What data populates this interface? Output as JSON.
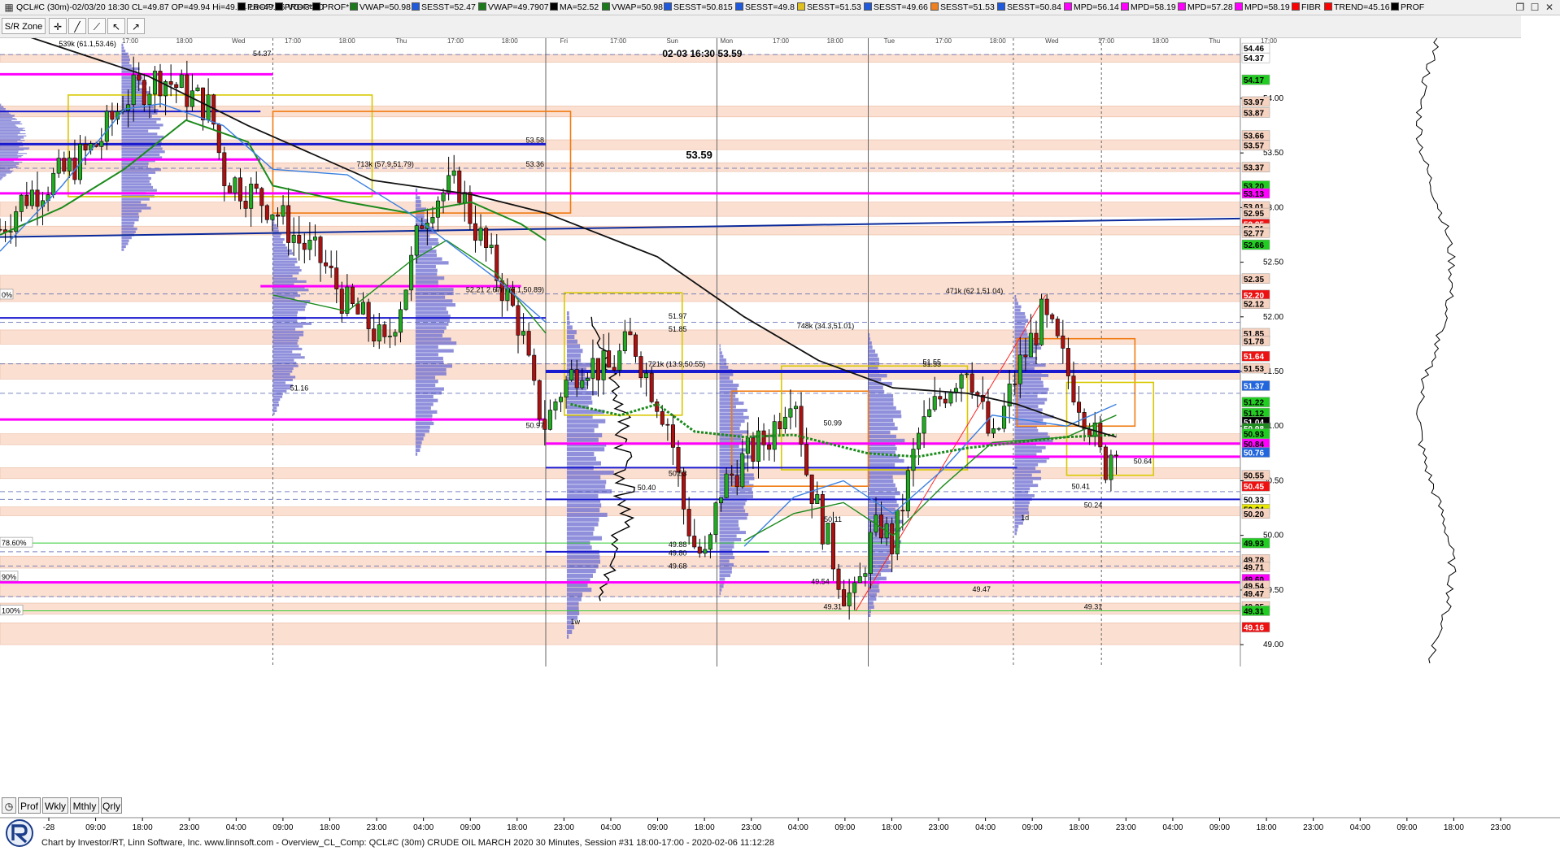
{
  "window": {
    "symbol_info": "QCL#C (30m)-02/03/20 18:30 CL=49.87 OP=49.94 Hi=49.94 Lo=49.66 VO=3410",
    "indicators": [
      {
        "label": "PROF*",
        "color": "#000000"
      },
      {
        "label": "PROF*",
        "color": "#000000"
      },
      {
        "label": "PROF*",
        "color": "#000000"
      },
      {
        "label": "VWAP=50.98",
        "color": "#1a7a1a"
      },
      {
        "label": "SESST=52.47",
        "color": "#1e5adb"
      },
      {
        "label": "VWAP=49.7907",
        "color": "#1a7a1a"
      },
      {
        "label": "MA=52.52",
        "color": "#000000"
      },
      {
        "label": "VWAP=50.98",
        "color": "#1a7a1a"
      },
      {
        "label": "SESST=50.815",
        "color": "#1e5adb"
      },
      {
        "label": "SESST=49.8",
        "color": "#1e5adb"
      },
      {
        "label": "SESST=51.53",
        "color": "#e0c020"
      },
      {
        "label": "SESST=49.66",
        "color": "#1e5adb"
      },
      {
        "label": "SESST=51.53",
        "color": "#f08020"
      },
      {
        "label": "SESST=50.84",
        "color": "#1e5adb"
      },
      {
        "label": "MPD=56.14",
        "color": "#ff00ff"
      },
      {
        "label": "MPD=58.19",
        "color": "#ff00ff"
      },
      {
        "label": "MPD=57.28",
        "color": "#ff00ff"
      },
      {
        "label": "MPD=58.19",
        "color": "#ff00ff"
      },
      {
        "label": "FIBR",
        "color": "#ff0000"
      },
      {
        "label": "TREND=45.16",
        "color": "#ff0000"
      },
      {
        "label": "PROF",
        "color": "#000000"
      }
    ],
    "toolbar_label": "PROF",
    "toolbar_icons": [
      "grid-icon",
      "stack-icon",
      "zoom-icon",
      "bars-icon",
      "wave-icon",
      "title-icon",
      "wave2-icon",
      "hourglass-icon"
    ]
  },
  "toolbar2": {
    "sr_zone_label": "S/R Zone",
    "tools": [
      "cross-icon",
      "line-icon",
      "line2-icon",
      "pointer-icon",
      "arrow-icon"
    ]
  },
  "bottom_tabs": [
    "Prof",
    "Wkly",
    "Mthly",
    "Qrly"
  ],
  "footer": {
    "text": "Chart by Investor/RT, Linn Software, Inc. www.linnsoft.com - Overview_CL_Comp: QCL#C (30m) CRUDE OIL MARCH 2020 30 Minutes, Session #31 18:00-17:00 - 2020-02-06 11:12:28"
  },
  "colors": {
    "zone_fill": "#fbe0d2",
    "magenta": "#ff00ff",
    "blue_line": "#1a1acf",
    "navy": "#0a2a9a",
    "green_vwap": "#1c8a1c",
    "ma": "#111111",
    "profile": "#6a6ad0",
    "up_candle": "#22aa22",
    "down_candle": "#aa1111",
    "orange": "#f07a10",
    "yellow": "#d8c800"
  },
  "chart_data": {
    "type": "candlestick",
    "title": "02-03 16:30  53.59",
    "subtitle": "53.59",
    "ylim": [
      48.8,
      54.55
    ],
    "y_tick_labels": [
      "54.00",
      "53.50",
      "53.00",
      "52.50",
      "52.00",
      "51.50",
      "51.00",
      "50.50",
      "50.00",
      "49.50",
      "49.00"
    ],
    "y_ticks": [
      54.0,
      53.5,
      53.0,
      52.5,
      52.0,
      51.5,
      51.0,
      50.5,
      50.0,
      49.5,
      49.0
    ],
    "x_tick_labels": [
      "-28",
      "09:00",
      "18:00",
      "23:00",
      "04:00",
      "09:00",
      "18:00",
      "23:00",
      "04:00",
      "09:00",
      "18:00",
      "23:00",
      "04:00",
      "09:00",
      "18:00",
      "23:00",
      "04:00",
      "09:00",
      "18:00",
      "23:00",
      "04:00",
      "09:00",
      "18:00",
      "23:00",
      "04:00",
      "09:00",
      "18:00",
      "23:00",
      "04:00",
      "09:00",
      "18:00",
      "23:00"
    ],
    "day_labels": [
      "17:00",
      "18:00",
      "Wed",
      "17:00",
      "18:00",
      "Thu",
      "17:00",
      "18:00",
      "Fri",
      "17:00",
      "Sun",
      "Mon",
      "17:00",
      "18:00",
      "Tue",
      "17:00",
      "18:00",
      "Wed",
      "17:00",
      "18:00",
      "Thu",
      "17:00"
    ],
    "price_labels": [
      {
        "value": 54.37,
        "label": "54.37",
        "bg": "#ffffff",
        "fg": "#000000"
      },
      {
        "value": 54.46,
        "label": "54.46",
        "bg": "#ffffff",
        "fg": "#000000"
      },
      {
        "value": 54.17,
        "label": "54.17",
        "bg": "#22cc22",
        "fg": "#000000"
      },
      {
        "value": 53.97,
        "label": "53.97",
        "bg": "#f6d2c0",
        "fg": "#000000"
      },
      {
        "value": 53.87,
        "label": "53.87",
        "bg": "#f6d2c0",
        "fg": "#000000"
      },
      {
        "value": 53.66,
        "label": "53.66",
        "bg": "#f6d2c0",
        "fg": "#000000"
      },
      {
        "value": 53.57,
        "label": "53.57",
        "bg": "#f6d2c0",
        "fg": "#000000"
      },
      {
        "value": 53.37,
        "label": "53.37",
        "bg": "#f6d2c0",
        "fg": "#000000"
      },
      {
        "value": 53.2,
        "label": "53.20",
        "bg": "#22cc22",
        "fg": "#000000"
      },
      {
        "value": 53.13,
        "label": "53.13",
        "bg": "#ff00ff",
        "fg": "#000000"
      },
      {
        "value": 53.01,
        "label": "53.01",
        "bg": "#f6d2c0",
        "fg": "#000000"
      },
      {
        "value": 52.95,
        "label": "52.95",
        "bg": "#f6d2c0",
        "fg": "#000000"
      },
      {
        "value": 52.85,
        "label": "52.85",
        "bg": "#ee1111",
        "fg": "#ffffff"
      },
      {
        "value": 52.81,
        "label": "52.81",
        "bg": "#f6d2c0",
        "fg": "#000000"
      },
      {
        "value": 52.77,
        "label": "52.77",
        "bg": "#f6d2c0",
        "fg": "#000000"
      },
      {
        "value": 52.66,
        "label": "52.66",
        "bg": "#22cc22",
        "fg": "#000000"
      },
      {
        "value": 52.35,
        "label": "52.35",
        "bg": "#f6d2c0",
        "fg": "#000000"
      },
      {
        "value": 52.2,
        "label": "52.20",
        "bg": "#ee1111",
        "fg": "#ffffff"
      },
      {
        "value": 52.12,
        "label": "52.12",
        "bg": "#f6d2c0",
        "fg": "#000000"
      },
      {
        "value": 51.85,
        "label": "51.85",
        "bg": "#f6d2c0",
        "fg": "#000000"
      },
      {
        "value": 51.78,
        "label": "51.78",
        "bg": "#f6d2c0",
        "fg": "#000000"
      },
      {
        "value": 51.64,
        "label": "51.64",
        "bg": "#ee1111",
        "fg": "#ffffff"
      },
      {
        "value": 51.53,
        "label": "51.53",
        "bg": "#f6d2c0",
        "fg": "#000000"
      },
      {
        "value": 51.37,
        "label": "51.37",
        "bg": "#2266dd",
        "fg": "#ffffff"
      },
      {
        "value": 51.22,
        "label": "51.22",
        "bg": "#22cc22",
        "fg": "#000000"
      },
      {
        "value": 51.12,
        "label": "51.12",
        "bg": "#22cc22",
        "fg": "#000000"
      },
      {
        "value": 51.04,
        "label": "51.04",
        "bg": "#000000",
        "fg": "#ffffff"
      },
      {
        "value": 50.98,
        "label": "50.98",
        "bg": "#1c8a1c",
        "fg": "#ffffff"
      },
      {
        "value": 50.93,
        "label": "50.93",
        "bg": "#22cc22",
        "fg": "#000000"
      },
      {
        "value": 50.84,
        "label": "50.84",
        "bg": "#ff00ff",
        "fg": "#000000"
      },
      {
        "value": 50.76,
        "label": "50.76",
        "bg": "#2266dd",
        "fg": "#ffffff"
      },
      {
        "value": 50.55,
        "label": "50.55",
        "bg": "#f6d2c0",
        "fg": "#000000"
      },
      {
        "value": 50.45,
        "label": "50.45",
        "bg": "#ee1111",
        "fg": "#ffffff"
      },
      {
        "value": 50.33,
        "label": "50.33",
        "bg": "#ffffff",
        "fg": "#000000"
      },
      {
        "value": 50.24,
        "label": "50.24",
        "bg": "#e8e800",
        "fg": "#000000"
      },
      {
        "value": 50.2,
        "label": "50.20",
        "bg": "#f6d2c0",
        "fg": "#000000"
      },
      {
        "value": 49.93,
        "label": "49.93",
        "bg": "#22cc22",
        "fg": "#000000"
      },
      {
        "value": 49.78,
        "label": "49.78",
        "bg": "#f6d2c0",
        "fg": "#000000"
      },
      {
        "value": 49.71,
        "label": "49.71",
        "bg": "#f6d2c0",
        "fg": "#000000"
      },
      {
        "value": 49.6,
        "label": "49.60",
        "bg": "#ff00ff",
        "fg": "#000000"
      },
      {
        "value": 49.54,
        "label": "49.54",
        "bg": "#f6d2c0",
        "fg": "#000000"
      },
      {
        "value": 49.47,
        "label": "49.47",
        "bg": "#f6d2c0",
        "fg": "#000000"
      },
      {
        "value": 49.35,
        "label": "49.35",
        "bg": "#f6d2c0",
        "fg": "#000000"
      },
      {
        "value": 49.31,
        "label": "49.31",
        "bg": "#22cc22",
        "fg": "#000000"
      },
      {
        "value": 49.16,
        "label": "49.16",
        "bg": "#ee1111",
        "fg": "#ffffff"
      }
    ],
    "zones": [
      [
        54.33,
        54.4
      ],
      [
        53.83,
        53.93
      ],
      [
        53.53,
        53.62
      ],
      [
        53.33,
        53.41
      ],
      [
        52.92,
        53.05
      ],
      [
        52.75,
        52.83
      ],
      [
        52.14,
        52.38
      ],
      [
        51.75,
        51.88
      ],
      [
        51.43,
        51.57
      ],
      [
        50.83,
        50.93
      ],
      [
        50.52,
        50.62
      ],
      [
        50.18,
        50.26
      ],
      [
        49.7,
        49.81
      ],
      [
        49.44,
        49.55
      ],
      [
        49.28,
        49.38
      ],
      [
        49.0,
        49.2
      ]
    ],
    "magenta_levels": [
      {
        "value": 54.22,
        "x0": 0,
        "x1": 0.22
      },
      {
        "value": 53.44,
        "x0": 0,
        "x1": 0.21
      },
      {
        "value": 53.13,
        "x0": 0,
        "x1": 1.0
      },
      {
        "value": 52.28,
        "x0": 0.21,
        "x1": 0.42
      },
      {
        "value": 51.06,
        "x0": 0,
        "x1": 0.44
      },
      {
        "value": 50.84,
        "x0": 0.44,
        "x1": 1.0
      },
      {
        "value": 50.72,
        "x0": 0.78,
        "x1": 1.0
      },
      {
        "value": 49.57,
        "x0": 0,
        "x1": 1.0
      }
    ],
    "blue_levels": [
      {
        "value": 53.58,
        "x0": 0,
        "x1": 0.44,
        "w": 3
      },
      {
        "value": 53.88,
        "x0": 0,
        "x1": 0.21,
        "w": 2
      },
      {
        "value": 51.99,
        "x0": 0,
        "x1": 0.44,
        "w": 2
      },
      {
        "value": 51.5,
        "x0": 0.44,
        "x1": 1.0,
        "w": 4
      },
      {
        "value": 50.62,
        "x0": 0.44,
        "x1": 0.82,
        "w": 2
      },
      {
        "value": 50.33,
        "x0": 0.44,
        "x1": 1.0,
        "w": 2
      },
      {
        "value": 49.85,
        "x0": 0.44,
        "x1": 0.62,
        "w": 2
      }
    ],
    "green_levels": [
      49.93,
      49.31
    ],
    "level_texts": [
      {
        "value": 54.37,
        "x": 0.22,
        "label": "54.37"
      },
      {
        "value": 53.58,
        "x": 0.44,
        "label": "53.58"
      },
      {
        "value": 53.36,
        "x": 0.44,
        "label": "53.36"
      },
      {
        "value": 52.21,
        "x": 0.44,
        "label": "52.21  2.67m (7.1,50.89)"
      },
      {
        "value": 51.97,
        "x": 0.555,
        "label": "51.97"
      },
      {
        "value": 51.85,
        "x": 0.555,
        "label": "51.85"
      },
      {
        "value": 51.53,
        "x": 0.57,
        "label": "721k (13.9,50.55)"
      },
      {
        "value": 51.88,
        "x": 0.69,
        "label": "748k (34.3,51.01)"
      },
      {
        "value": 52.2,
        "x": 0.81,
        "label": "471k (62.1,51.04)"
      },
      {
        "value": 53.36,
        "x": 0.335,
        "label": "713k (57.9,51.79)"
      },
      {
        "value": 54.46,
        "x": 0.095,
        "label": "539k (61.1,53.46)"
      },
      {
        "value": 51.31,
        "x": 0.25,
        "label": "51.16"
      },
      {
        "value": 50.97,
        "x": 0.44,
        "label": "50.97"
      },
      {
        "value": 50.53,
        "x": 0.555,
        "label": "50.53"
      },
      {
        "value": 50.4,
        "x": 0.53,
        "label": "50.40"
      },
      {
        "value": 50.99,
        "x": 0.68,
        "label": "50.99"
      },
      {
        "value": 50.11,
        "x": 0.68,
        "label": "50.11"
      },
      {
        "value": 49.54,
        "x": 0.67,
        "label": "49.54"
      },
      {
        "value": 49.31,
        "x": 0.68,
        "label": "49.31"
      },
      {
        "value": 49.47,
        "x": 0.8,
        "label": "49.47"
      },
      {
        "value": 49.31,
        "x": 0.89,
        "label": "49.31"
      },
      {
        "value": 50.24,
        "x": 0.89,
        "label": "50.24"
      },
      {
        "value": 50.41,
        "x": 0.88,
        "label": "50.41"
      },
      {
        "value": 50.64,
        "x": 0.93,
        "label": "50.64"
      },
      {
        "value": 51.53,
        "x": 0.76,
        "label": "51.53"
      },
      {
        "value": 51.55,
        "x": 0.76,
        "label": "51.55"
      },
      {
        "value": 49.88,
        "x": 0.555,
        "label": "49.88"
      },
      {
        "value": 49.8,
        "x": 0.555,
        "label": "49.80"
      },
      {
        "value": 49.68,
        "x": 0.555,
        "label": "49.68"
      }
    ],
    "pct_labels": [
      {
        "value": 52.2,
        "label": "0%"
      },
      {
        "value": 49.93,
        "label": "78.60%"
      },
      {
        "value": 49.62,
        "label": "90%"
      },
      {
        "value": 49.31,
        "label": "100%"
      }
    ],
    "ma_points": [
      [
        0,
        54.65
      ],
      [
        0.12,
        54.2
      ],
      [
        0.2,
        53.75
      ],
      [
        0.3,
        53.25
      ],
      [
        0.38,
        53.12
      ],
      [
        0.44,
        52.95
      ],
      [
        0.53,
        52.55
      ],
      [
        0.6,
        52.0
      ],
      [
        0.66,
        51.6
      ],
      [
        0.72,
        51.35
      ],
      [
        0.78,
        51.3
      ],
      [
        0.82,
        51.2
      ],
      [
        0.87,
        51.0
      ],
      [
        0.9,
        50.9
      ]
    ],
    "candles_seed": 7,
    "close_path": [
      [
        0,
        52.8
      ],
      [
        0.02,
        53.1
      ],
      [
        0.05,
        53.3
      ],
      [
        0.08,
        53.6
      ],
      [
        0.1,
        54.0
      ],
      [
        0.13,
        54.2
      ],
      [
        0.15,
        54.05
      ],
      [
        0.17,
        53.9
      ],
      [
        0.18,
        53.3
      ],
      [
        0.2,
        53.15
      ],
      [
        0.22,
        53.0
      ],
      [
        0.24,
        52.7
      ],
      [
        0.26,
        52.5
      ],
      [
        0.28,
        52.1
      ],
      [
        0.3,
        51.9
      ],
      [
        0.31,
        51.7
      ],
      [
        0.33,
        52.4
      ],
      [
        0.34,
        52.9
      ],
      [
        0.35,
        53.1
      ],
      [
        0.37,
        53.2
      ],
      [
        0.38,
        52.9
      ],
      [
        0.4,
        52.4
      ],
      [
        0.42,
        51.9
      ],
      [
        0.43,
        51.3
      ],
      [
        0.44,
        51.0
      ],
      [
        0.45,
        51.3
      ],
      [
        0.47,
        51.6
      ],
      [
        0.49,
        51.5
      ],
      [
        0.51,
        51.8
      ],
      [
        0.52,
        51.5
      ],
      [
        0.54,
        51.0
      ],
      [
        0.55,
        50.3
      ],
      [
        0.56,
        49.9
      ],
      [
        0.57,
        49.75
      ],
      [
        0.58,
        50.4
      ],
      [
        0.6,
        50.7
      ],
      [
        0.62,
        50.9
      ],
      [
        0.64,
        51.4
      ],
      [
        0.65,
        50.6
      ],
      [
        0.66,
        50.2
      ],
      [
        0.68,
        49.5
      ],
      [
        0.69,
        49.4
      ],
      [
        0.7,
        49.9
      ],
      [
        0.71,
        50.1
      ],
      [
        0.72,
        49.9
      ],
      [
        0.73,
        50.4
      ],
      [
        0.74,
        50.9
      ],
      [
        0.76,
        51.3
      ],
      [
        0.78,
        51.6
      ],
      [
        0.8,
        50.8
      ],
      [
        0.82,
        51.5
      ],
      [
        0.84,
        52.0
      ],
      [
        0.85,
        51.8
      ],
      [
        0.86,
        51.5
      ],
      [
        0.88,
        51.0
      ],
      [
        0.89,
        50.6
      ],
      [
        0.9,
        50.9
      ]
    ],
    "x_axis_days": [
      "Tue",
      "Wed",
      "Thu",
      "Fri",
      "Sun/Mon",
      "Tue",
      "Wed",
      "Thu"
    ]
  }
}
